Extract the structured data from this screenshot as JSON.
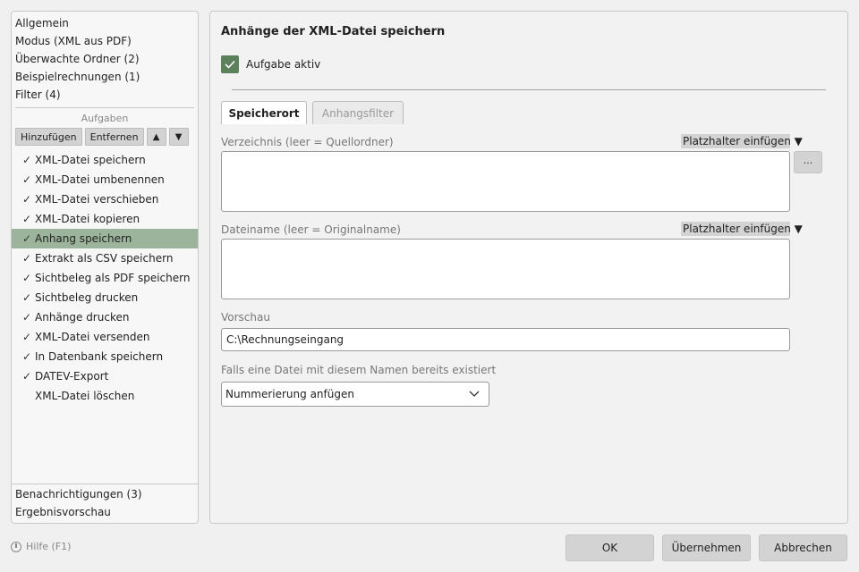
{
  "sidebar": {
    "nav_top": [
      "Allgemein",
      "Modus (XML aus PDF)",
      "Überwachte Ordner (2)",
      "Beispielrechnungen (1)",
      "Filter (4)"
    ],
    "tasks_label": "Aufgaben",
    "add_label": "Hinzufügen",
    "remove_label": "Entfernen",
    "up_icon": "▲",
    "down_icon": "▼",
    "tasks": [
      {
        "label": "XML-Datei speichern",
        "checked": "✓"
      },
      {
        "label": "XML-Datei umbenennen",
        "checked": "✓"
      },
      {
        "label": "XML-Datei verschieben",
        "checked": "✓"
      },
      {
        "label": "XML-Datei kopieren",
        "checked": "✓"
      },
      {
        "label": "Anhang speichern",
        "checked": "✓"
      },
      {
        "label": "Extrakt als CSV speichern",
        "checked": "✓"
      },
      {
        "label": "Sichtbeleg als PDF speichern",
        "checked": "✓"
      },
      {
        "label": "Sichtbeleg drucken",
        "checked": "✓"
      },
      {
        "label": "Anhänge drucken",
        "checked": "✓"
      },
      {
        "label": "XML-Datei versenden",
        "checked": "✓"
      },
      {
        "label": "In Datenbank speichern",
        "checked": "✓"
      },
      {
        "label": "DATEV-Export",
        "checked": "✓"
      },
      {
        "label": "XML-Datei löschen",
        "checked": ""
      }
    ],
    "nav_bottom": [
      "Benachrichtigungen (3)",
      "Ergebnisvorschau"
    ]
  },
  "main": {
    "title": "Anhänge der XML-Datei speichern",
    "active_label": "Aufgabe aktiv",
    "tabs": [
      {
        "label": "Speicherort"
      },
      {
        "label": "Anhangsfilter"
      }
    ],
    "directory_label": "Verzeichnis (leer = Quellordner)",
    "placeholder_button": "Platzhalter einfügen ▼",
    "browse_label": "...",
    "filename_label": "Dateiname (leer = Originalname)",
    "preview_label": "Vorschau",
    "preview_value": "C:\\Rechnungseingang",
    "exists_label": "Falls eine Datei mit diesem Namen bereits existiert",
    "exists_value": "Nummerierung anfügen"
  },
  "footer": {
    "help_label": "Hilfe (F1)",
    "ok_label": "OK",
    "apply_label": "Übernehmen",
    "cancel_label": "Abbrechen"
  },
  "colors": {
    "selected_row": "#9bb49b",
    "checkbox_accent": "#5c7f5c"
  }
}
